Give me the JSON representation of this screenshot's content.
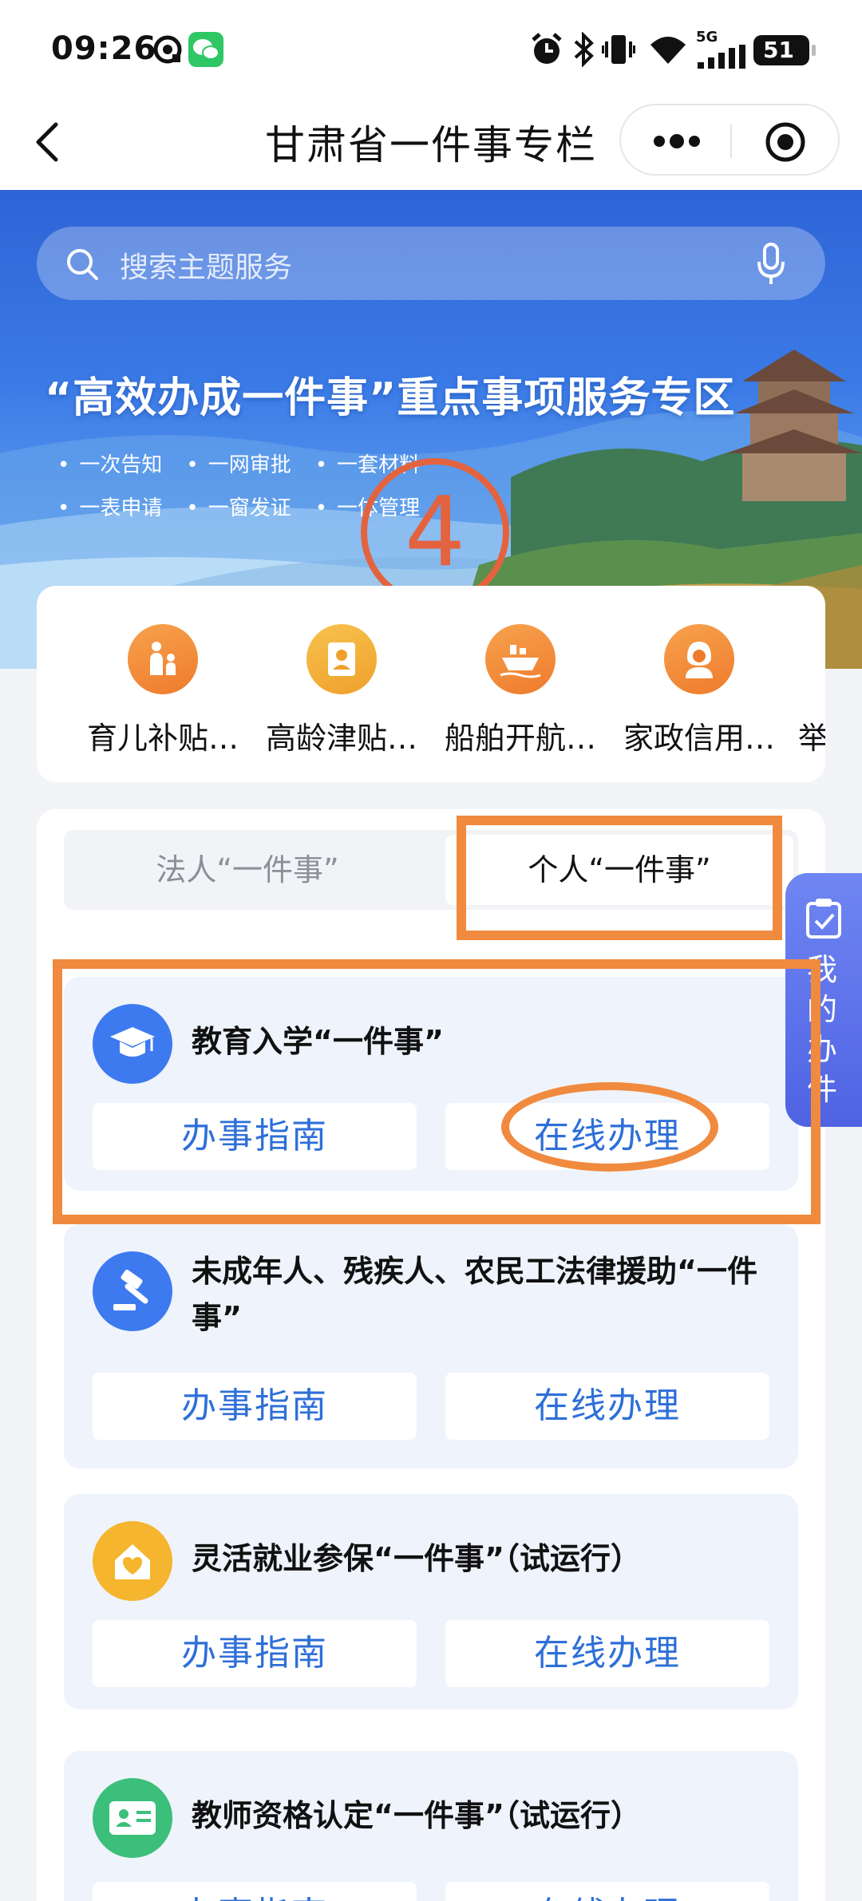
{
  "status_bar": {
    "time": "09:26",
    "network": "5G",
    "battery": "51",
    "icons": [
      "alarm-icon",
      "bluetooth-icon",
      "vibrate-icon",
      "wifi-icon",
      "signal-icon"
    ]
  },
  "nav": {
    "title": "甘肃省一件事专栏"
  },
  "search": {
    "placeholder": "搜索主题服务"
  },
  "banner": {
    "title": "“高效办成一件事”重点事项服务专区",
    "bullets": [
      "一次告知",
      "一网审批",
      "一套材料",
      "一表申请",
      "一窗发证",
      "一体管理"
    ],
    "step_marker": "4"
  },
  "quick_services": [
    {
      "label": "育儿补贴…",
      "icon": "child-care-icon"
    },
    {
      "label": "高龄津贴…",
      "icon": "elderly-icon"
    },
    {
      "label": "船舶开航…",
      "icon": "ship-icon"
    },
    {
      "label": "家政信用…",
      "icon": "housekeeper-icon"
    },
    {
      "label": "举",
      "icon": ""
    }
  ],
  "tabs": {
    "legal": "法人“一件事”",
    "personal": "个人“一件事”",
    "active": "personal"
  },
  "items": [
    {
      "title": "教育入学“一件事”",
      "guide": "办事指南",
      "online": "在线办理",
      "icon": "graduation-cap-icon",
      "color": "#3d7af0"
    },
    {
      "title": "未成年人、残疾人、农民工法律援助“一件事”",
      "guide": "办事指南",
      "online": "在线办理",
      "icon": "gavel-icon",
      "color": "#3d7af0"
    },
    {
      "title": "灵活就业参保“一件事”（试运行）",
      "guide": "办事指南",
      "online": "在线办理",
      "icon": "house-heart-icon",
      "color": "#f5b52e"
    },
    {
      "title": "教师资格认定“一件事”（试运行）",
      "guide": "办事指南",
      "online": "在线办理",
      "icon": "id-card-icon",
      "color": "#3cbf7a"
    }
  ],
  "floating": {
    "label": "我的办件"
  },
  "colors": {
    "accent": "#2e6fd8",
    "annotation": "#f08a3e",
    "step_marker": "#e3633e"
  }
}
